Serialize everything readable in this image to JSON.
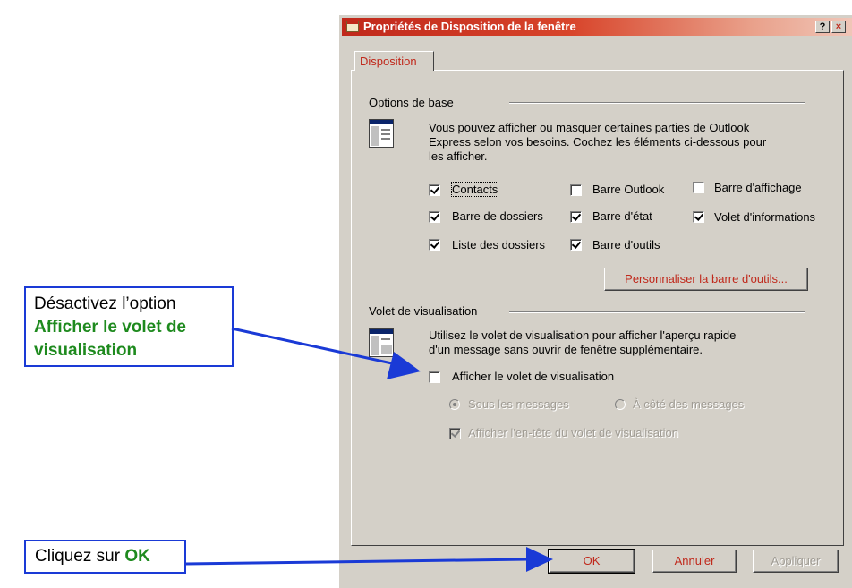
{
  "dialog": {
    "title": "Propriétés de Disposition de la fenêtre",
    "help_label": "?",
    "close_label": "×",
    "tab_label": "Disposition",
    "basic_options": {
      "label": "Options de base",
      "description_1": "Vous pouvez afficher ou masquer certaines parties de Outlook",
      "description_2": "Express selon vos besoins. Cochez les éléments ci-dessous pour",
      "description_3": "les afficher."
    },
    "options": {
      "contacts": "Contacts",
      "outlook_bar": "Barre Outlook",
      "display_bar": "Barre d'affichage",
      "folder_bar": "Barre de dossiers",
      "status_bar": "Barre d'état",
      "info_pane": "Volet d'informations",
      "folder_list": "Liste des dossiers",
      "toolbar": "Barre d'outils"
    },
    "customize_button": "Personnaliser la barre d'outils...",
    "preview": {
      "label": "Volet de visualisation",
      "description_1": "Utilisez le volet de visualisation pour afficher l'aperçu rapide",
      "description_2": "d'un message sans ouvrir de fenêtre supplémentaire.",
      "show_pane": "Afficher le volet de visualisation",
      "below_messages": "Sous les messages",
      "beside_messages": "À côté des messages",
      "show_header": "Afficher l'en-tête du volet de visualisation"
    },
    "buttons": {
      "ok": "OK",
      "cancel": "Annuler",
      "apply": "Appliquer"
    }
  },
  "annotations": {
    "callout_1_line_1": "Désactivez l’option",
    "callout_1_line_2": "Afficher le volet de",
    "callout_1_line_3": "visualisation",
    "callout_2_prefix": "Cliquez sur ",
    "callout_2_bold": "OK"
  },
  "colors": {
    "accent_red": "#c0281b",
    "callout_border": "#1a3ad6",
    "highlight_green": "#1e8a1e",
    "dialog_face": "#d4d0c8"
  }
}
